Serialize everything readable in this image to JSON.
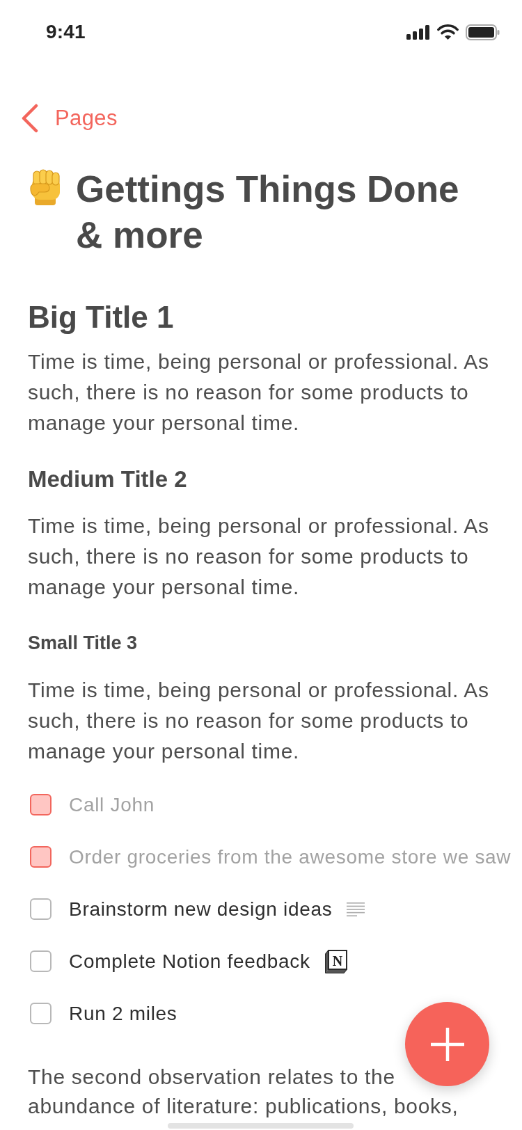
{
  "status_bar": {
    "time": "9:41"
  },
  "nav": {
    "back_label": "Pages"
  },
  "page": {
    "title": "Gettings Things Done & more"
  },
  "blocks": [
    {
      "kind": "heading_1",
      "text": "Big Title 1"
    },
    {
      "kind": "paragraph",
      "text": "Time is time, being personal or professional. As such, there is no reason for some products to manage your personal time."
    },
    {
      "kind": "heading_2",
      "text": "Medium Title 2"
    },
    {
      "kind": "paragraph",
      "text": "Time is time, being personal or professional. As such, there is no reason for some products to manage your personal time."
    },
    {
      "kind": "heading_3",
      "text": "Small Title 3"
    },
    {
      "kind": "paragraph",
      "text": "Time is time, being personal or professional. As such, there is no reason for some products to manage your personal time."
    },
    {
      "kind": "todo_list",
      "items": [
        {
          "text": "Call John",
          "checked": true
        },
        {
          "text": "Order groceries from the awesome store we saw",
          "checked": true
        },
        {
          "text": "Brainstorm new design ideas",
          "checked": false,
          "attachment": {
            "kind": "notes"
          }
        },
        {
          "text": "Complete Notion feedback",
          "checked": false,
          "attachment": {
            "kind": "logo",
            "letter": "N"
          }
        },
        {
          "text": "Run 2 miles",
          "checked": false
        }
      ]
    },
    {
      "kind": "paragraph",
      "text": "The second observation relates to the abundance of literature: publications, books,"
    }
  ]
}
